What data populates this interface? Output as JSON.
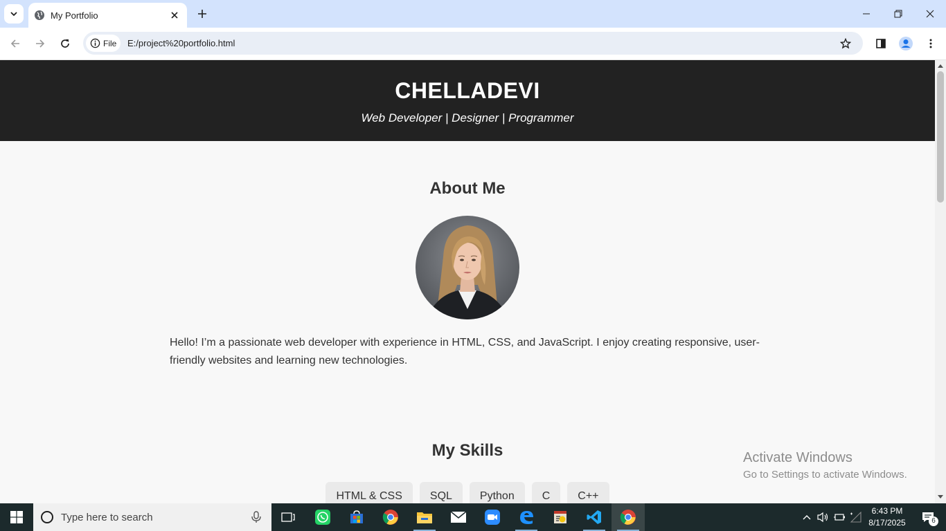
{
  "browser": {
    "tab_title": "My Portfolio",
    "site_chip_label": "File",
    "url": "E:/project%20portfolio.html",
    "icons": [
      "tab-search-icon",
      "globe-icon",
      "close-icon",
      "plus-icon",
      "minimize-icon",
      "restore-icon",
      "close-window-icon",
      "back-arrow-icon",
      "forward-arrow-icon",
      "reload-icon",
      "info-icon",
      "star-icon",
      "side-panel-icon",
      "profile-icon",
      "more-vert-icon"
    ]
  },
  "page": {
    "hero": {
      "name": "CHELLADEVI",
      "tagline": "Web Developer | Designer | Programmer"
    },
    "about": {
      "title": "About Me",
      "text": "Hello! I’m a passionate web developer with experience in HTML, CSS, and JavaScript. I enjoy creating responsive, user-friendly websites and learning new technologies."
    },
    "skills": {
      "title": "My Skills",
      "items": [
        "HTML & CSS",
        "SQL",
        "Python",
        "C",
        "C++"
      ]
    }
  },
  "overlay": {
    "activate_line1": "Activate Windows",
    "activate_line2": "Go to Settings to activate Windows."
  },
  "taskbar": {
    "search_placeholder": "Type here to search",
    "time": "6:43 PM",
    "date": "8/17/2025",
    "notification_count": "6",
    "apps": [
      "task-view",
      "whatsapp",
      "microsoft-store",
      "chrome",
      "file-explorer",
      "mail",
      "zoom",
      "edge",
      "media-app",
      "vscode",
      "chrome"
    ]
  },
  "colors": {
    "hero_bg": "#222222",
    "page_bg": "#f8f8f8",
    "tabstrip_bg": "#d3e3fd",
    "taskbar_bg": "#1c2a2c"
  }
}
